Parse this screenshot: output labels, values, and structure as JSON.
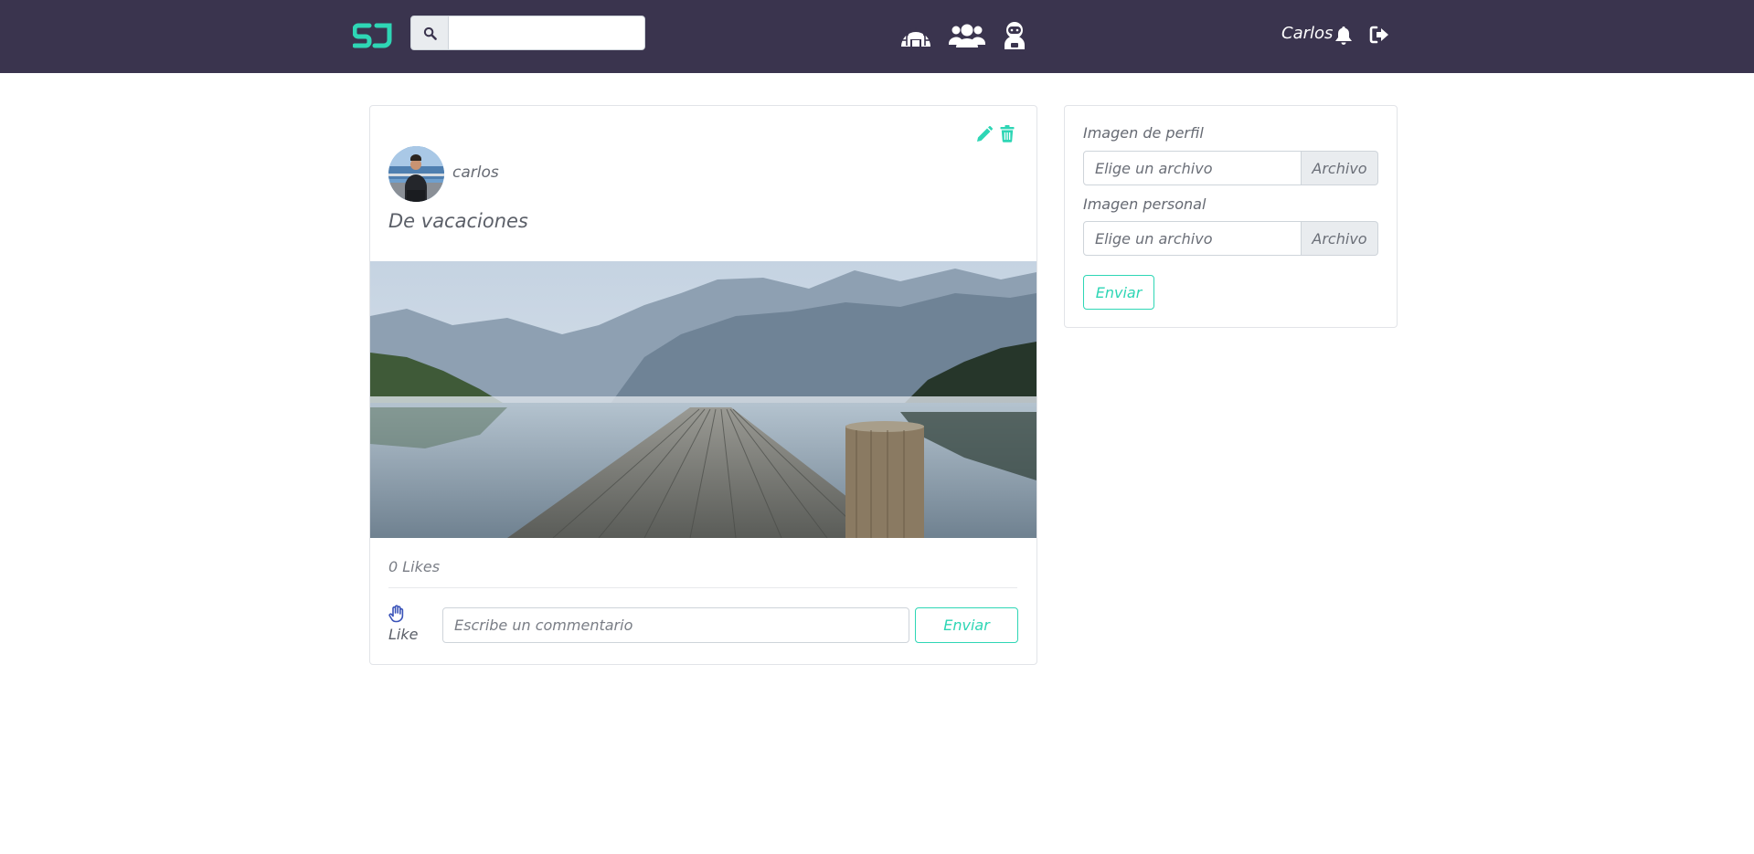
{
  "navbar": {
    "logo_icon": "sj-logo-icon",
    "search": {
      "icon": "search-icon",
      "value": "",
      "placeholder": ""
    },
    "nav_icons": [
      "igloo-icon",
      "users-icon",
      "user-astronaut-icon"
    ],
    "user_name": "Carlos",
    "bell_icon": "bell-icon",
    "logout_icon": "sign-out-icon"
  },
  "post": {
    "author": "carlos",
    "text": "De vacaciones",
    "likes_text": "0 Likes",
    "like_label": "Like",
    "like_icon": "hand-paper-icon",
    "comment_placeholder": "Escribe un commentario",
    "send_label": "Enviar",
    "edit_icon": "pencil-icon",
    "delete_icon": "trash-icon"
  },
  "profile_form": {
    "profile_image_label": "Imagen de perfil",
    "personal_image_label": "Imagen personal",
    "file_placeholder": "Elige un archivo",
    "browse_label": "Archivo",
    "send_label": "Enviar"
  },
  "colors": {
    "navbar_bg": "#3a344e",
    "accent": "#2ed6b5",
    "border": "#e2e4e8"
  }
}
